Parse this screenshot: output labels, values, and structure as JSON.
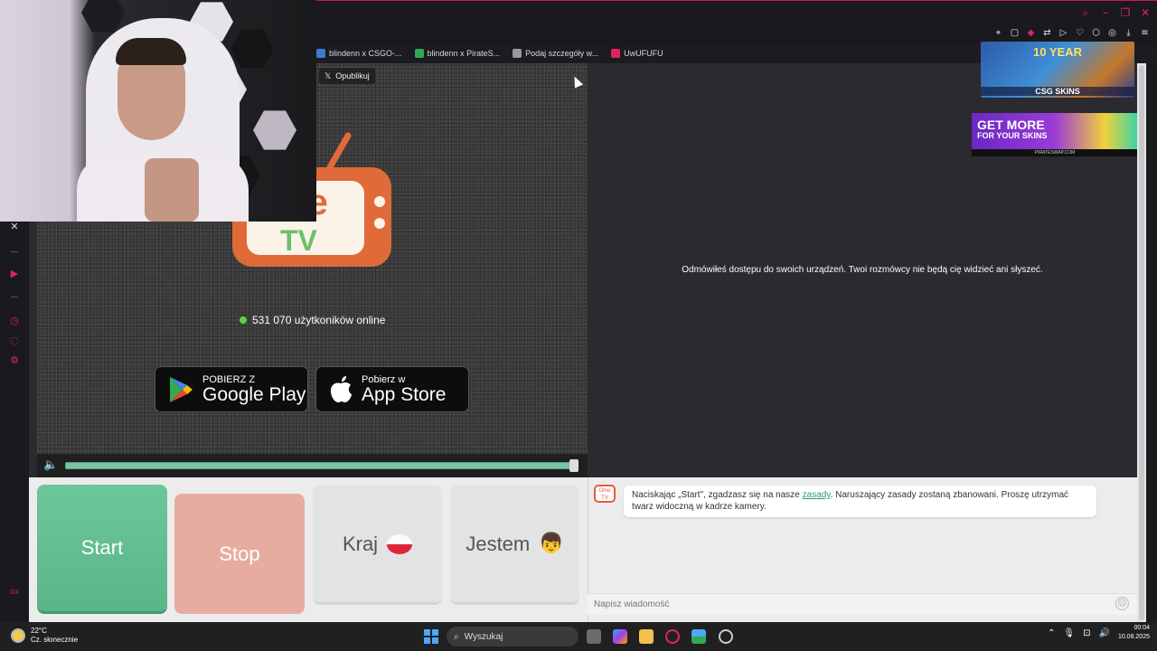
{
  "browser": {
    "bookmarks": [
      {
        "label": "blindenn x CSGO-...",
        "color": "#3a7bd5"
      },
      {
        "label": "blindenn x PirateS...",
        "color": "#34a853"
      },
      {
        "label": "Podaj szczegóły w...",
        "color": "#999999"
      },
      {
        "label": "UwUFUFU",
        "color": "#e0245e"
      }
    ],
    "window_icons": [
      "search-icon",
      "minimize-icon",
      "restore-icon",
      "close-icon"
    ],
    "toolbar_icons": [
      "pin-icon",
      "snapshot-icon",
      "pocket-icon",
      "translate-icon",
      "play-icon",
      "heart-icon",
      "extensions-icon",
      "account-icon",
      "download-icon",
      "menu-icon"
    ]
  },
  "video": {
    "publish_label": "Opublikuj",
    "logo_text_top": "me",
    "logo_text_bottom": "TV",
    "online_count": "531 070 użytkoników online",
    "google_play_small": "POBIERZ Z",
    "google_play_big": "Google Play",
    "app_store_small": "Pobierz w",
    "app_store_big": "App Store",
    "volume": 1.0
  },
  "remote": {
    "message": "Odmówiłeś dostępu do swoich urządzeń. Twoi rozmówcy nie będą cię widzieć ani słyszeć."
  },
  "ads": {
    "ad1_title": "10 YEAR",
    "ad1_brand": "CSG SKINS",
    "ad2_line1": "GET MORE",
    "ad2_line2": "FOR YOUR SKINS",
    "ad2_footer": "PIRATESWAP.COM"
  },
  "controls": {
    "start": "Start",
    "stop": "Stop",
    "country": "Kraj",
    "gender": "Jestem",
    "gender_emoji": "👦"
  },
  "chat": {
    "logo_text": "Ome TV",
    "notice_before": "Naciskając „Start\", zgadzasz się na nasze ",
    "notice_link": "zasady",
    "notice_after": ". Naruszający zasady zostaną zbanowani. Proszę utrzymać twarz widoczną w kadrze kamery.",
    "input_placeholder": "Napisz wiadomość"
  },
  "sidebar": {
    "label_bottom": "GX"
  },
  "taskbar": {
    "temperature": "22°C",
    "weather": "Cz. słonecznie",
    "search_label": "Wyszukaj",
    "time": "00:04",
    "date": "10.08.2025"
  }
}
